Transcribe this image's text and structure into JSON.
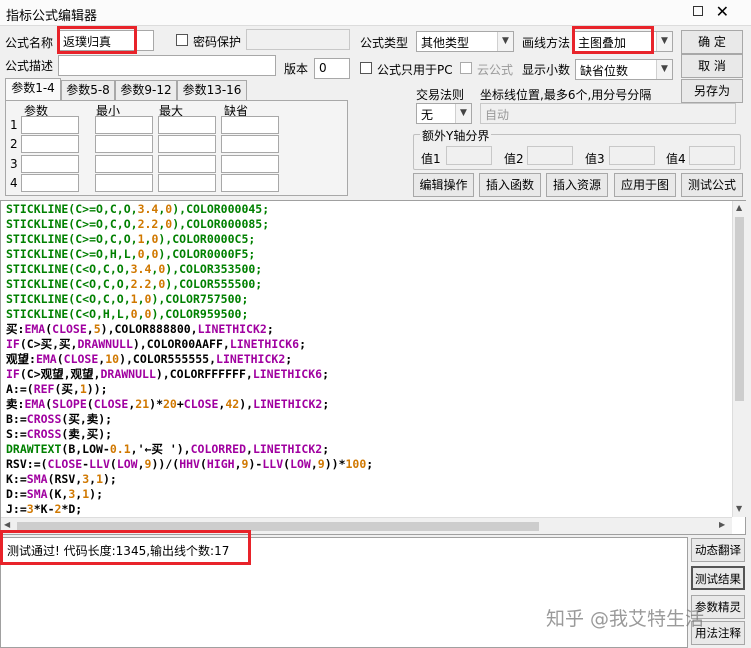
{
  "window": {
    "title": "指标公式编辑器"
  },
  "form": {
    "name_label": "公式名称",
    "name_value": "返璞归真",
    "password_label": "密码保护",
    "type_label": "公式类型",
    "type_value": "其他类型",
    "draw_label": "画线方法",
    "draw_value": "主图叠加",
    "desc_label": "公式描述",
    "version_label": "版本",
    "version_value": "0",
    "pc_only_label": "公式只用于PC",
    "cloud_label": "云公式",
    "decimals_label": "显示小数",
    "decimals_value": "缺省位数"
  },
  "buttons": {
    "ok": "确  定",
    "cancel": "取  消",
    "save_as": "另存为",
    "edit_op": "编辑操作",
    "insert_func": "插入函数",
    "insert_res": "插入资源",
    "apply_chart": "应用于图",
    "test_formula": "测试公式"
  },
  "params": {
    "tabs": [
      "参数1-4",
      "参数5-8",
      "参数9-12",
      "参数13-16"
    ],
    "headers": [
      "参数",
      "最小",
      "最大",
      "缺省"
    ],
    "rows": [
      "1",
      "2",
      "3",
      "4"
    ]
  },
  "trade": {
    "label": "交易法则",
    "value": "无"
  },
  "coord": {
    "label": "坐标线位置,最多6个,用分号分隔",
    "value": "自动"
  },
  "yaxis": {
    "label": "额外Y轴分界",
    "values": [
      "值1",
      "值2",
      "值3",
      "值4"
    ]
  },
  "code_lines": [
    [
      [
        "STICKLINE(C>=O,C,O,",
        "g"
      ],
      [
        "3.4",
        "o"
      ],
      [
        ",",
        "g"
      ],
      [
        "0",
        "o"
      ],
      [
        "),COLOR000045;",
        "g"
      ]
    ],
    [
      [
        "STICKLINE(C>=O,C,O,",
        "g"
      ],
      [
        "2.2",
        "o"
      ],
      [
        ",",
        "g"
      ],
      [
        "0",
        "o"
      ],
      [
        "),COLOR000085;",
        "g"
      ]
    ],
    [
      [
        "STICKLINE(C>=O,C,O,",
        "g"
      ],
      [
        "1",
        "o"
      ],
      [
        ",",
        "g"
      ],
      [
        "0",
        "o"
      ],
      [
        "),COLOR0000C5;",
        "g"
      ]
    ],
    [
      [
        "STICKLINE(C>=O,H,L,",
        "g"
      ],
      [
        "0",
        "o"
      ],
      [
        ",",
        "g"
      ],
      [
        "0",
        "o"
      ],
      [
        "),COLOR0000F5;",
        "g"
      ]
    ],
    [
      [
        "STICKLINE(C<O,C,O,",
        "g"
      ],
      [
        "3.4",
        "o"
      ],
      [
        ",",
        "g"
      ],
      [
        "0",
        "o"
      ],
      [
        "),COLOR353500;",
        "g"
      ]
    ],
    [
      [
        "STICKLINE(C<O,C,O,",
        "g"
      ],
      [
        "2.2",
        "o"
      ],
      [
        ",",
        "g"
      ],
      [
        "0",
        "o"
      ],
      [
        "),COLOR555500;",
        "g"
      ]
    ],
    [
      [
        "STICKLINE(C<O,C,O,",
        "g"
      ],
      [
        "1",
        "o"
      ],
      [
        ",",
        "g"
      ],
      [
        "0",
        "o"
      ],
      [
        "),COLOR757500;",
        "g"
      ]
    ],
    [
      [
        "STICKLINE(C<O,H,L,",
        "g"
      ],
      [
        "0",
        "o"
      ],
      [
        ",",
        "g"
      ],
      [
        "0",
        "o"
      ],
      [
        "),COLOR959500;",
        "g"
      ]
    ],
    [
      [
        "买:",
        "k"
      ],
      [
        "EMA",
        "m"
      ],
      [
        "(",
        "k"
      ],
      [
        "CLOSE",
        "m"
      ],
      [
        ",",
        "k"
      ],
      [
        "5",
        "o"
      ],
      [
        "),COLOR888800,",
        "k"
      ],
      [
        "LINETHICK2",
        "m"
      ],
      [
        ";",
        "k"
      ]
    ],
    [
      [
        "IF",
        "m"
      ],
      [
        "(C>买,买,",
        "k"
      ],
      [
        "DRAWNULL",
        "m"
      ],
      [
        "),COLOR00AAFF,",
        "k"
      ],
      [
        "LINETHICK6",
        "m"
      ],
      [
        ";",
        "k"
      ]
    ],
    [
      [
        "观望:",
        "k"
      ],
      [
        "EMA",
        "m"
      ],
      [
        "(",
        "k"
      ],
      [
        "CLOSE",
        "m"
      ],
      [
        ",",
        "k"
      ],
      [
        "10",
        "o"
      ],
      [
        "),COLOR555555,",
        "k"
      ],
      [
        "LINETHICK2",
        "m"
      ],
      [
        ";",
        "k"
      ]
    ],
    [
      [
        "IF",
        "m"
      ],
      [
        "(C>观望,观望,",
        "k"
      ],
      [
        "DRAWNULL",
        "m"
      ],
      [
        "),COLORFFFFFF,",
        "k"
      ],
      [
        "LINETHICK6",
        "m"
      ],
      [
        ";",
        "k"
      ]
    ],
    [
      [
        "A:=(",
        "k"
      ],
      [
        "REF",
        "m"
      ],
      [
        "(买,",
        "k"
      ],
      [
        "1",
        "o"
      ],
      [
        "));",
        "k"
      ]
    ],
    [
      [
        "卖:",
        "k"
      ],
      [
        "EMA",
        "m"
      ],
      [
        "(",
        "k"
      ],
      [
        "SLOPE",
        "m"
      ],
      [
        "(",
        "k"
      ],
      [
        "CLOSE",
        "m"
      ],
      [
        ",",
        "k"
      ],
      [
        "21",
        "o"
      ],
      [
        ")*",
        "k"
      ],
      [
        "20",
        "o"
      ],
      [
        "+",
        "k"
      ],
      [
        "CLOSE",
        "m"
      ],
      [
        ",",
        "k"
      ],
      [
        "42",
        "o"
      ],
      [
        "),",
        "k"
      ],
      [
        "LINETHICK2",
        "m"
      ],
      [
        ";",
        "k"
      ]
    ],
    [
      [
        "B:=",
        "k"
      ],
      [
        "CROSS",
        "m"
      ],
      [
        "(买,卖);",
        "k"
      ]
    ],
    [
      [
        "S:=",
        "k"
      ],
      [
        "CROSS",
        "m"
      ],
      [
        "(卖,买);",
        "k"
      ]
    ],
    [
      [
        "DRAWTEXT",
        "g"
      ],
      [
        "(B,LOW-",
        "k"
      ],
      [
        "0.1",
        "o"
      ],
      [
        ",'←买 '),",
        "k"
      ],
      [
        "COLORRED",
        "m"
      ],
      [
        ",",
        "k"
      ],
      [
        "LINETHICK2",
        "m"
      ],
      [
        ";",
        "k"
      ]
    ],
    [
      [
        "RSV:=(",
        "k"
      ],
      [
        "CLOSE",
        "m"
      ],
      [
        "-",
        "k"
      ],
      [
        "LLV",
        "m"
      ],
      [
        "(",
        "k"
      ],
      [
        "LOW",
        "m"
      ],
      [
        ",",
        "k"
      ],
      [
        "9",
        "o"
      ],
      [
        "))/(",
        "k"
      ],
      [
        "HHV",
        "m"
      ],
      [
        "(",
        "k"
      ],
      [
        "HIGH",
        "m"
      ],
      [
        ",",
        "k"
      ],
      [
        "9",
        "o"
      ],
      [
        ")-",
        "k"
      ],
      [
        "LLV",
        "m"
      ],
      [
        "(",
        "k"
      ],
      [
        "LOW",
        "m"
      ],
      [
        ",",
        "k"
      ],
      [
        "9",
        "o"
      ],
      [
        "))*",
        "k"
      ],
      [
        "100",
        "o"
      ],
      [
        ";",
        "k"
      ]
    ],
    [
      [
        "K:=",
        "k"
      ],
      [
        "SMA",
        "m"
      ],
      [
        "(RSV,",
        "k"
      ],
      [
        "3",
        "o"
      ],
      [
        ",",
        "k"
      ],
      [
        "1",
        "o"
      ],
      [
        ");",
        "k"
      ]
    ],
    [
      [
        "D:=",
        "k"
      ],
      [
        "SMA",
        "m"
      ],
      [
        "(K,",
        "k"
      ],
      [
        "3",
        "o"
      ],
      [
        ",",
        "k"
      ],
      [
        "1",
        "o"
      ],
      [
        ");",
        "k"
      ]
    ],
    [
      [
        "J:=",
        "k"
      ],
      [
        "3",
        "o"
      ],
      [
        "*K-",
        "k"
      ],
      [
        "2",
        "o"
      ],
      [
        "*D;",
        "k"
      ]
    ]
  ],
  "colors": {
    "g": "#008000",
    "k": "#000000",
    "m": "#a000a0",
    "o": "#d07800",
    "highlight": "#e8232a"
  },
  "status_text": "测试通过! 代码长度:1345,输出线个数:17",
  "side_buttons": [
    "动态翻译",
    "测试结果",
    "参数精灵",
    "用法注释"
  ],
  "watermark": "知乎 @我艾特生活"
}
